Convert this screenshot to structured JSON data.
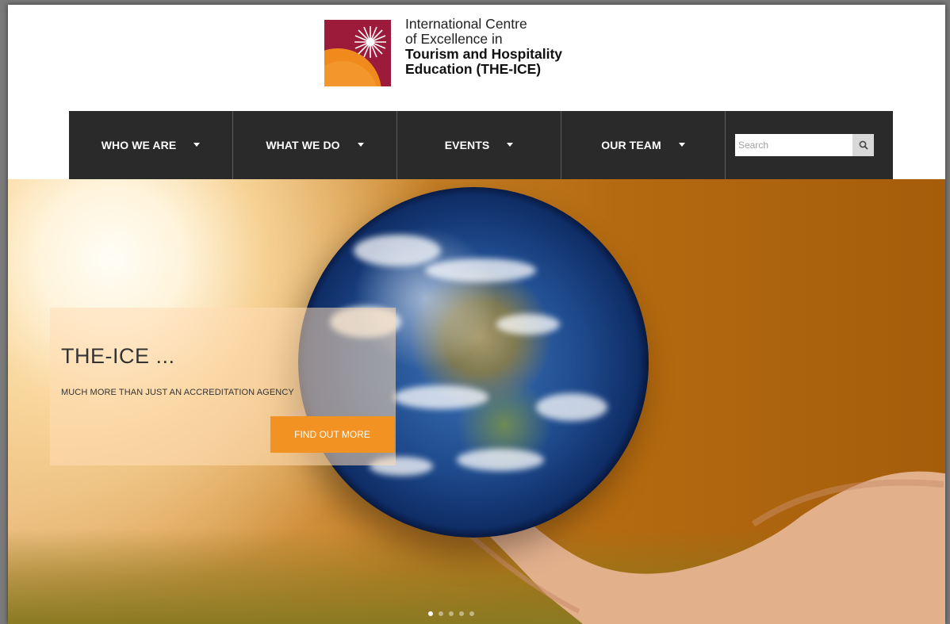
{
  "logo": {
    "line1": "International Centre",
    "line2": "of Excellence in",
    "line3": "Tourism and Hospitality",
    "line4": "Education (THE-ICE)"
  },
  "nav": {
    "items": [
      {
        "label": "WHO WE ARE"
      },
      {
        "label": "WHAT WE DO"
      },
      {
        "label": "EVENTS"
      },
      {
        "label": "OUR TEAM"
      }
    ],
    "search": {
      "placeholder": "Search",
      "icon": "search-icon"
    }
  },
  "hero": {
    "title": "THE-ICE ...",
    "subtitle": "MUCH MORE THAN JUST AN ACCREDITATION AGENCY",
    "button_label": "FIND OUT MORE",
    "slide_count": 5,
    "active_slide": 1
  },
  "colors": {
    "nav_bg": "#2a2a2a",
    "accent": "#f29222",
    "logo_red": "#9c1b3a",
    "logo_orange": "#f08a1c"
  }
}
